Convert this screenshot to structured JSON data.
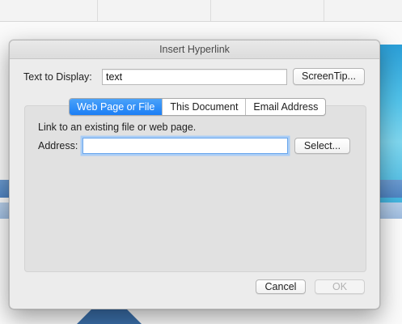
{
  "dialog": {
    "title": "Insert Hyperlink",
    "text_to_display_label": "Text to Display:",
    "text_to_display_value": "text",
    "screentip_button": "ScreenTip...",
    "tabs": [
      {
        "label": "Web Page or File",
        "active": true
      },
      {
        "label": "This Document",
        "active": false
      },
      {
        "label": "Email Address",
        "active": false
      }
    ],
    "link_description": "Link to an existing file or web page.",
    "address_label": "Address:",
    "address_value": "",
    "select_button": "Select...",
    "cancel_button": "Cancel",
    "ok_button": "OK",
    "ok_enabled": false
  },
  "colors": {
    "accent": "#1b7ef5",
    "focus_ring": "#a9cdf6",
    "dialog_bg": "#ececec"
  }
}
